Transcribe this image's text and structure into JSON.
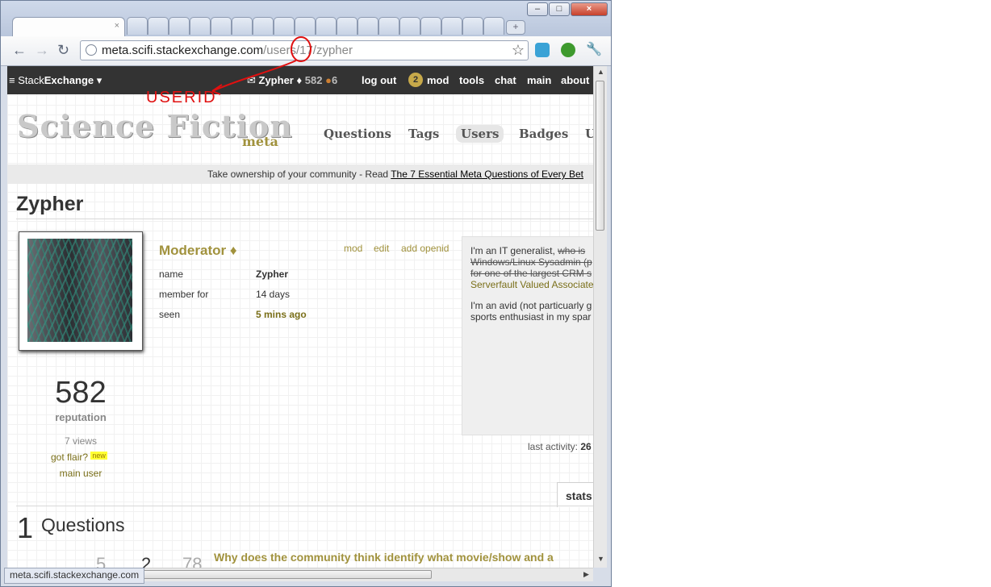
{
  "browser": {
    "url_domain": "meta.scifi.stackexchange.com",
    "url_rest": "/users/17/zypher",
    "status_url": "meta.scifi.stackexchange.com",
    "new_tab_glyph": "+",
    "tab_close_glyph": "×"
  },
  "se_bar": {
    "brand_prefix": "Stack",
    "brand_bold": "Exchange",
    "user_name": "Zypher",
    "diamond": "♦",
    "reputation": "582",
    "bronze_badges": "6",
    "logout": "log out",
    "mod_count": "2",
    "mod": "mod",
    "tools": "tools",
    "chat": "chat",
    "main": "main",
    "about": "about"
  },
  "header": {
    "logo": "Science Fiction",
    "logo_sub": "meta",
    "nav": [
      "Questions",
      "Tags",
      "Users",
      "Badges",
      "U"
    ]
  },
  "announcement": {
    "text": "Take ownership of your community - Read ",
    "link": "The 7 Essential Meta Questions of Every Bet"
  },
  "profile": {
    "name": "Zypher",
    "role": "Moderator ♦",
    "actions": [
      "mod",
      "edit",
      "add openid"
    ],
    "fields": [
      {
        "label": "name",
        "value": "Zypher"
      },
      {
        "label": "member for",
        "value": "14 days"
      },
      {
        "label": "seen",
        "value": "5 mins ago"
      }
    ],
    "reputation": "582",
    "reputation_label": "reputation",
    "views": "7 views",
    "flair": "got flair?",
    "flair_badge": "new",
    "main_user": "main user",
    "last_activity_label": "last activity:",
    "last_activity_value": "26"
  },
  "about_me": {
    "p1_start": "I'm an IT generalist, ",
    "p1_strike1": "who is",
    "p1_strike2": "Windows/Linux Sysadmin (p",
    "p1_strike3": "for one of the largest CRM s",
    "p1_link": "Serverfault Valued Associate",
    "p2_line1": "I'm an avid (not particuarly g",
    "p2_line2": "sports enthusiast in my spar"
  },
  "tabs": {
    "stats": "stats"
  },
  "questions": {
    "count": "1",
    "label": "Questions",
    "item": {
      "votes": "5",
      "answers": "2",
      "views": "78",
      "title": "Why does the community think identify what movie/show and a"
    }
  },
  "annotation": {
    "text": "USERID"
  },
  "colors": {
    "accent": "#a1923d",
    "link": "#7a6f19",
    "topbar": "#333333",
    "annotation": "#e01010"
  }
}
